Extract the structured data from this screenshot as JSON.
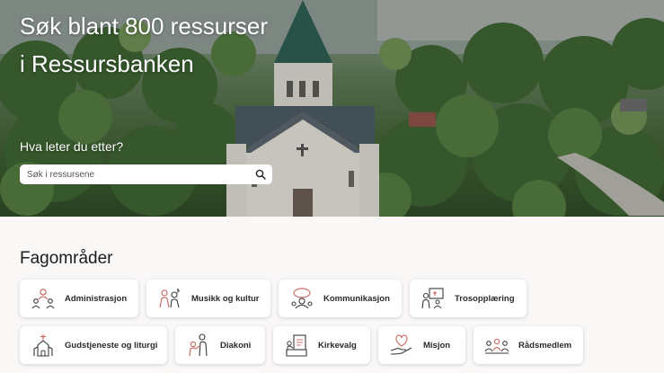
{
  "hero": {
    "title_line1": "Søk blant 800 ressurser",
    "title_line2": "i Ressursbanken",
    "search_label": "Hva leter du etter?",
    "search_placeholder": "Søk i ressursene",
    "search_icon": "search-icon"
  },
  "fagomrader": {
    "title": "Fagområder",
    "items": [
      {
        "label": "Administrasjon",
        "icon": "administration-icon"
      },
      {
        "label": "Musikk og kultur",
        "icon": "music-culture-icon"
      },
      {
        "label": "Kommunikasjon",
        "icon": "communication-icon"
      },
      {
        "label": "Trosopplæring",
        "icon": "faith-education-icon"
      },
      {
        "label": "Gudstjeneste og liturgi",
        "icon": "church-icon"
      },
      {
        "label": "Diakoni",
        "icon": "diakonia-icon"
      },
      {
        "label": "Kirkevalg",
        "icon": "ballot-icon"
      },
      {
        "label": "Misjon",
        "icon": "heart-hand-icon"
      },
      {
        "label": "Rådsmedlem",
        "icon": "council-members-icon"
      }
    ]
  },
  "colors": {
    "icon_accent": "#c9706a",
    "icon_line": "#3a3a3a",
    "background": "#faf8f7"
  }
}
